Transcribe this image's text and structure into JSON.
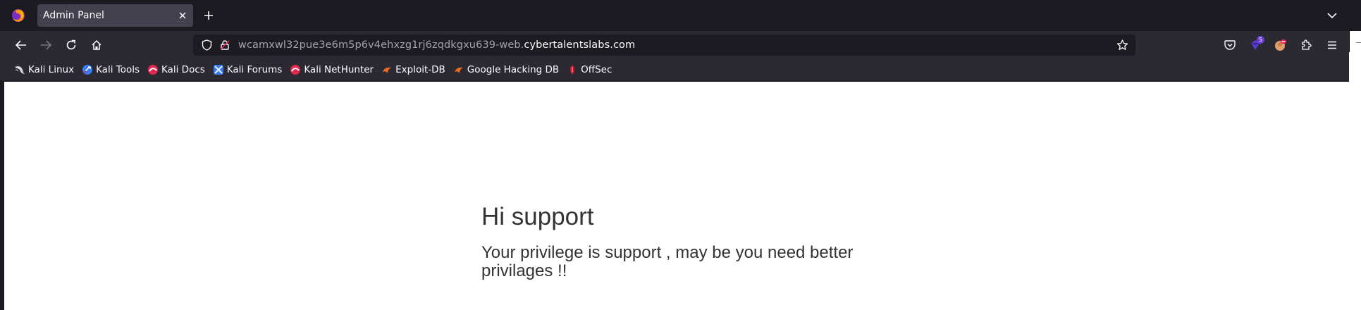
{
  "browser": {
    "tab": {
      "title": "Admin Panel"
    },
    "url": {
      "prefix": "wcamxwl32pue3e6m5p6v4ehxzg1rj6zqdkgxu639-web.",
      "host": "cybertalentslabs.com"
    },
    "extensions_badge": "5",
    "icons": {
      "browser_logo": "firefox-logo-icon",
      "close": "close-icon",
      "new_tab": "plus-icon",
      "list_tabs": "chevron-down-icon",
      "back": "back-arrow-icon",
      "forward": "forward-arrow-icon",
      "reload": "reload-icon",
      "home": "home-icon",
      "tracking": "shield-icon",
      "insecure": "lock-strike-icon",
      "bookmark_star": "star-icon",
      "pocket": "pocket-icon",
      "extension_badge": "extension-badge-icon",
      "account": "avatar-icon",
      "extensions": "puzzle-icon",
      "menu": "hamburger-menu-icon"
    }
  },
  "bookmarks": [
    {
      "label": "Kali Linux",
      "icon": "kali-dragon-icon"
    },
    {
      "label": "Kali Tools",
      "icon": "kali-tools-icon"
    },
    {
      "label": "Kali Docs",
      "icon": "kali-docs-icon"
    },
    {
      "label": "Kali Forums",
      "icon": "kali-forums-icon"
    },
    {
      "label": "Kali NetHunter",
      "icon": "kali-nethunter-icon"
    },
    {
      "label": "Exploit-DB",
      "icon": "exploit-db-icon"
    },
    {
      "label": "Google Hacking DB",
      "icon": "ghdb-icon"
    },
    {
      "label": "OffSec",
      "icon": "offsec-icon"
    }
  ],
  "page": {
    "heading": "Hi support",
    "message": "Your privilege is support , may be you need better privilages !!"
  },
  "colors": {
    "chrome_dark": "#1c1b22",
    "toolbar": "#2b2a33",
    "tab_active": "#42414d",
    "page_bg": "#ffffff",
    "page_text": "#333333"
  }
}
